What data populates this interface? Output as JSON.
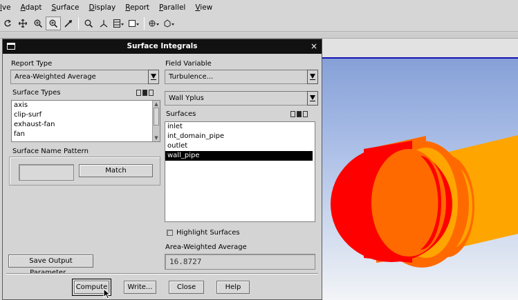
{
  "menubar": {
    "items": [
      "lve",
      "Adapt",
      "Surface",
      "Display",
      "Report",
      "Parallel",
      "View"
    ]
  },
  "toolbar": {
    "icons": [
      "rotate-icon",
      "pan-icon",
      "zoom-in-icon",
      "zoom-box-icon",
      "probe-icon",
      "zoom-fit-icon",
      "axes-icon",
      "layout-icon",
      "window-icon",
      "view-icon",
      "display-icon"
    ]
  },
  "dialog": {
    "title": "Surface Integrals",
    "close_glyph": "×",
    "report_type": {
      "label": "Report Type",
      "value": "Area-Weighted Average"
    },
    "field_variable": {
      "label": "Field Variable",
      "category": "Turbulence...",
      "variable": "Wall Yplus"
    },
    "surface_types": {
      "label": "Surface Types",
      "items": [
        "axis",
        "clip-surf",
        "exhaust-fan",
        "fan"
      ]
    },
    "surfaces": {
      "label": "Surfaces",
      "items": [
        "inlet",
        "int_domain_pipe",
        "outlet",
        "wall_pipe"
      ],
      "selected": "wall_pipe"
    },
    "surface_name_pattern": {
      "label": "Surface Name Pattern",
      "value": "",
      "match_label": "Match"
    },
    "highlight_surfaces": {
      "label": "Highlight Surfaces",
      "checked": false
    },
    "result": {
      "label": "Area-Weighted Average",
      "value": "16.8727"
    },
    "save_output_label": "Save Output Parameter...",
    "buttons": {
      "compute": "Compute",
      "write": "Write...",
      "close": "Close",
      "help": "Help"
    }
  },
  "viewport": {
    "colors": {
      "outer_ring": "#ff0000",
      "inner_ring": "#ff6a00",
      "far_ring": "#ffa500",
      "band": "#1414b4"
    }
  }
}
